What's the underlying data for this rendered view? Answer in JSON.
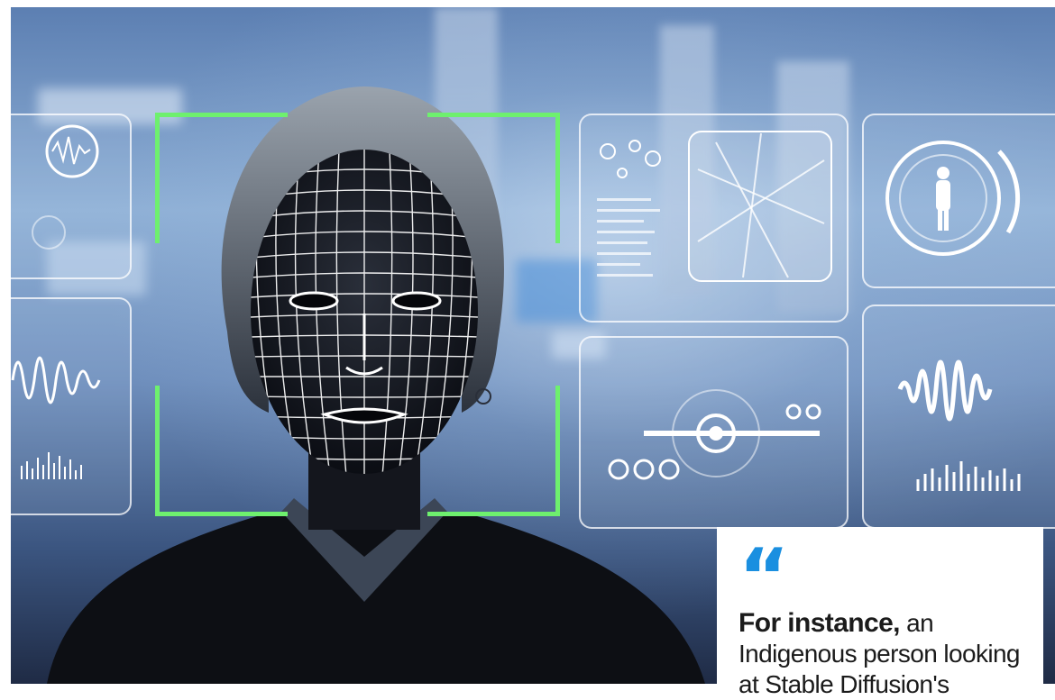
{
  "photo": {
    "subject": "woman-face-scan",
    "bracket_color": "#6ef06e",
    "mesh_color": "#ffffff"
  },
  "quote": {
    "mark": "“",
    "lead": "For instance,",
    "text": " an Indigenous person looking at Stable Diffusion's",
    "accent_color": "#1a8fe0"
  }
}
